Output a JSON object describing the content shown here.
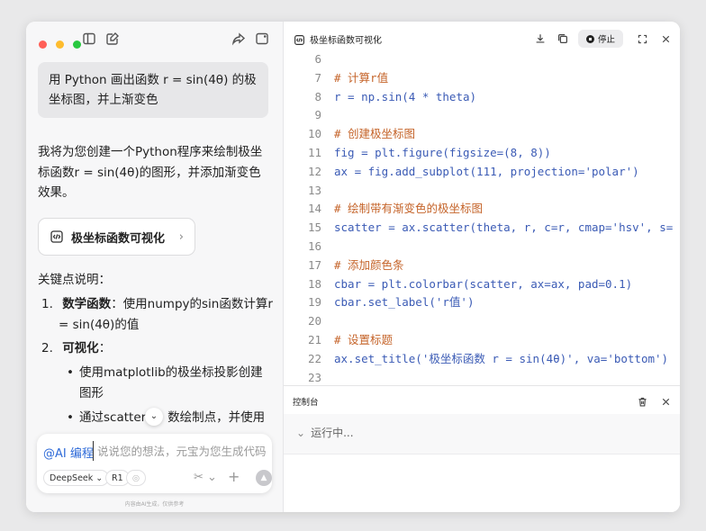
{
  "left": {
    "user_message": "用 Python 画出函数 r = sin(4θ) 的极坐标图，并上渐变色",
    "answer_intro": "我将为您创建一个Python程序来绘制极坐标函数r = sin(4θ)的图形，并添加渐变色效果。",
    "artifact_card": "极坐标函数可视化",
    "keypoints_heading": "关键点说明：",
    "list": [
      {
        "num": "1.",
        "bold": "数学函数",
        "text": "：使用numpy的sin函数计算r",
        "cont": "= sin(4θ)的值"
      },
      {
        "num": "2.",
        "bold": "可视化",
        "text": "："
      }
    ],
    "bullets": [
      {
        "line1": "使用matplotlib的极坐标投影创建",
        "line2": "图形"
      },
      {
        "line1": "通过scatter",
        "line1b": "数绘制点，并使用"
      }
    ],
    "composer": {
      "mention": "@AI 编程",
      "placeholder": "说说您的想法，元宝为您生成代码",
      "model_chip": "DeepSeek",
      "r1_chip": "R1"
    },
    "footnote": "内容由AI生成，仅供参考"
  },
  "right": {
    "title": "极坐标函数可视化",
    "stop_label": "停止",
    "code_lines": [
      {
        "n": "6",
        "t": "",
        "c": false
      },
      {
        "n": "7",
        "t": "# 计算r值",
        "c": true
      },
      {
        "n": "8",
        "t": "r = np.sin(4 * theta)",
        "c": false
      },
      {
        "n": "9",
        "t": "",
        "c": false
      },
      {
        "n": "10",
        "t": "# 创建极坐标图",
        "c": true
      },
      {
        "n": "11",
        "t": "fig = plt.figure(figsize=(8, 8))",
        "c": false
      },
      {
        "n": "12",
        "t": "ax = fig.add_subplot(111, projection='polar')",
        "c": false
      },
      {
        "n": "13",
        "t": "",
        "c": false
      },
      {
        "n": "14",
        "t": "# 绘制带有渐变色的极坐标图",
        "c": true
      },
      {
        "n": "15",
        "t": "scatter = ax.scatter(theta, r, c=r, cmap='hsv', s=",
        "c": false
      },
      {
        "n": "16",
        "t": "",
        "c": false
      },
      {
        "n": "17",
        "t": "# 添加颜色条",
        "c": true
      },
      {
        "n": "18",
        "t": "cbar = plt.colorbar(scatter, ax=ax, pad=0.1)",
        "c": false
      },
      {
        "n": "19",
        "t": "cbar.set_label('r值')",
        "c": false
      },
      {
        "n": "20",
        "t": "",
        "c": false
      },
      {
        "n": "21",
        "t": "# 设置标题",
        "c": true
      },
      {
        "n": "22",
        "t": "ax.set_title('极坐标函数 r = sin(4θ)', va='bottom')",
        "c": false
      },
      {
        "n": "23",
        "t": "",
        "c": false
      }
    ],
    "console": {
      "title": "控制台",
      "status": "运行中..."
    }
  }
}
